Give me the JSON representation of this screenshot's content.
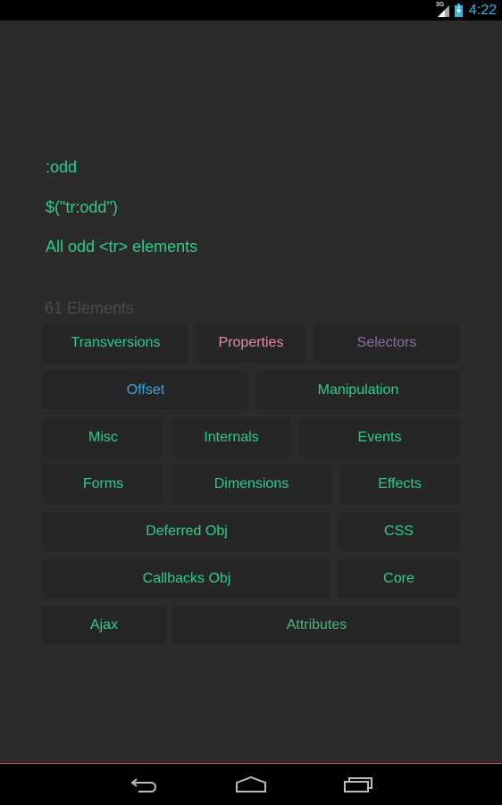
{
  "status_bar": {
    "network_type": "3G",
    "signal_icon": "signal-icon",
    "battery_icon": "battery-charging-icon",
    "time": "4:22",
    "accent_color": "#33b5e5"
  },
  "detail": {
    "name": ":odd",
    "usage": "$(\"tr:odd\")",
    "description": "All odd <tr> elements"
  },
  "elements_count": "61 Elements",
  "categories": [
    {
      "label": "Transversions",
      "color": "#2ecc8a"
    },
    {
      "label": "Properties",
      "color": "#e48ba9"
    },
    {
      "label": "Selectors",
      "color": "#8c6fa8"
    },
    {
      "label": "Offset",
      "color": "#3aa3d8"
    },
    {
      "label": "Manipulation",
      "color": "#2ecc8a"
    },
    {
      "label": "Misc",
      "color": "#2ecc8a"
    },
    {
      "label": "Internals",
      "color": "#2ecc8a"
    },
    {
      "label": "Events",
      "color": "#2ecc8a"
    },
    {
      "label": "Forms",
      "color": "#2ecc8a"
    },
    {
      "label": "Dimensions",
      "color": "#2ecc8a"
    },
    {
      "label": "Effects",
      "color": "#2ecc8a"
    },
    {
      "label": "Deferred Obj",
      "color": "#2ecc8a"
    },
    {
      "label": "CSS",
      "color": "#2ecc8a"
    },
    {
      "label": "Callbacks Obj",
      "color": "#2ecc8a"
    },
    {
      "label": "Core",
      "color": "#2ecc8a"
    },
    {
      "label": "Ajax",
      "color": "#2ecc8a"
    },
    {
      "label": "Attributes",
      "color": "#4fb57c"
    }
  ],
  "nav_bar": {
    "back_icon": "back-icon",
    "home_icon": "home-icon",
    "recents_icon": "recents-icon"
  }
}
